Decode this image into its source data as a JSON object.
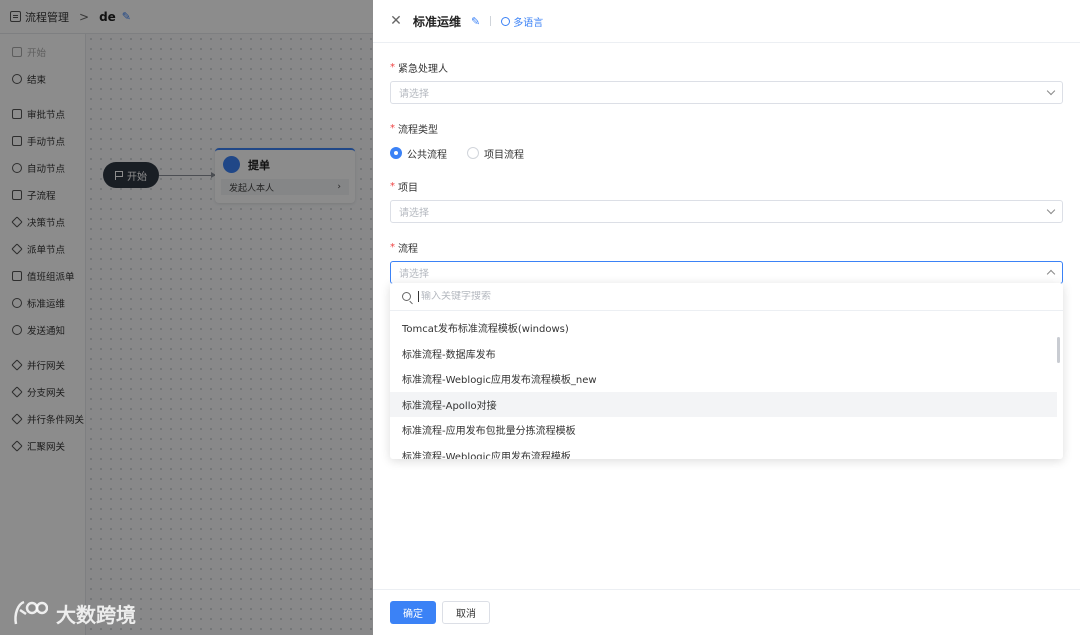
{
  "topbar": {
    "breadcrumb": "流程管理",
    "separator": ">",
    "flow_name": "de",
    "edit_icon": "pencil-icon"
  },
  "sidebar": {
    "items": [
      {
        "label": "开始",
        "icon": "flag-icon"
      },
      {
        "label": "结束",
        "icon": "stop-circle-icon"
      },
      {
        "label": "审批节点",
        "icon": "approve-icon"
      },
      {
        "label": "手动节点",
        "icon": "hand-icon"
      },
      {
        "label": "自动节点",
        "icon": "auto-icon"
      },
      {
        "label": "子流程",
        "icon": "subflow-icon"
      },
      {
        "label": "决策节点",
        "icon": "diamond-icon"
      },
      {
        "label": "派单节点",
        "icon": "dispatch-icon"
      },
      {
        "label": "值班组派单",
        "icon": "calendar-icon"
      },
      {
        "label": "标准运维",
        "icon": "clock-icon"
      },
      {
        "label": "发送通知",
        "icon": "bell-icon"
      },
      {
        "label": "并行网关",
        "icon": "gateway-icon"
      },
      {
        "label": "分支网关",
        "icon": "gateway-icon"
      },
      {
        "label": "并行条件网关",
        "icon": "gateway-icon"
      },
      {
        "label": "汇聚网关",
        "icon": "gateway-icon"
      }
    ]
  },
  "canvas": {
    "start_node": "开始",
    "task_node": {
      "title": "提单",
      "row": "发起人本人"
    }
  },
  "drawer": {
    "title": "标准运维",
    "lang_link": "多语言",
    "fields": {
      "urgent_handler": {
        "label": "紧急处理人",
        "placeholder": "请选择"
      },
      "flow_type": {
        "label": "流程类型",
        "options": [
          "公共流程",
          "项目流程"
        ],
        "selected": "公共流程"
      },
      "project": {
        "label": "项目",
        "placeholder": "请选择"
      },
      "flow": {
        "label": "流程",
        "placeholder": "请选择"
      }
    },
    "dropdown": {
      "search_placeholder": "输入关键字搜索",
      "options": [
        "Tomcat发布标准流程模板(windows)",
        "标准流程-数据库发布",
        "标准流程-Weblogic应用发布流程模板_new",
        "标准流程-Apollo对接",
        "标准流程-应用发布包批量分拣流程模板",
        "标准流程-Weblogic应用发布流程模板"
      ],
      "hovered": "标准流程-Apollo对接"
    },
    "footer": {
      "confirm": "确定",
      "cancel": "取消"
    }
  },
  "watermark": {
    "text": "大数跨境"
  },
  "colors": {
    "primary": "#3b82f6",
    "required": "#ef4444"
  }
}
